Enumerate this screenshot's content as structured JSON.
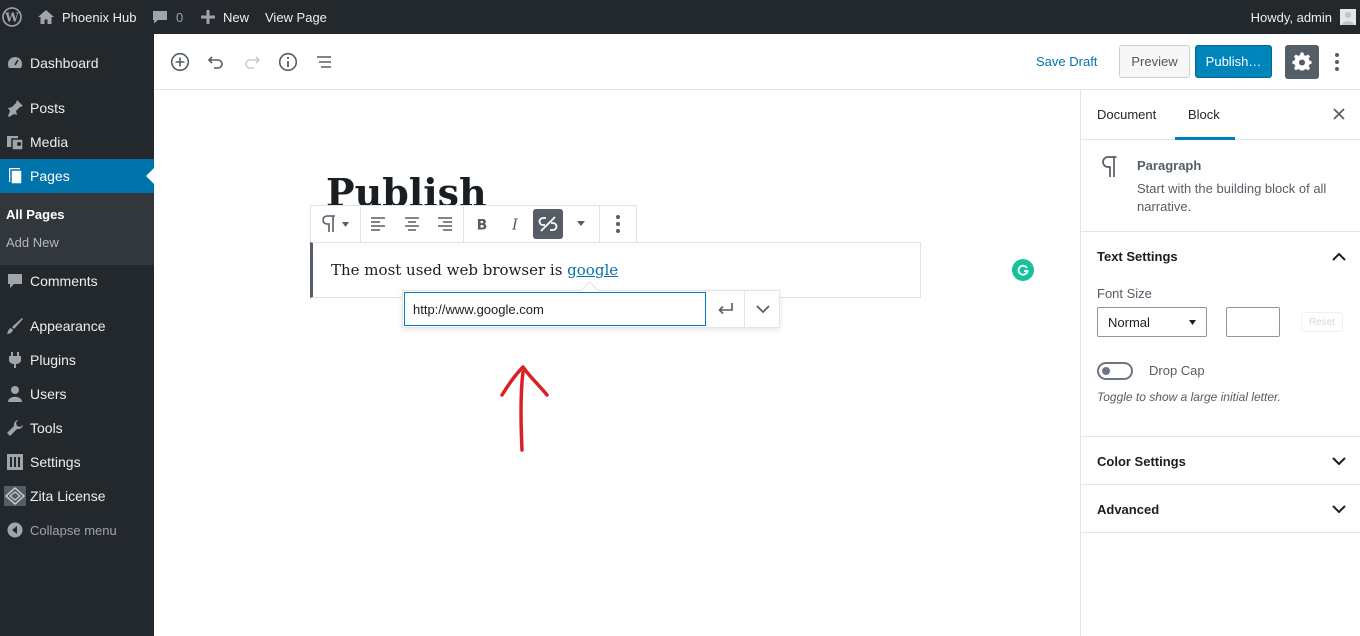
{
  "adminbar": {
    "site_name": "Phoenix Hub",
    "comments_count": "0",
    "new_label": "New",
    "view_page": "View Page",
    "greeting": "Howdy, admin"
  },
  "sidebar": {
    "items": [
      {
        "label": "Dashboard",
        "icon": "dashboard-icon"
      },
      {
        "label": "Posts",
        "icon": "pin-icon"
      },
      {
        "label": "Media",
        "icon": "media-icon"
      },
      {
        "label": "Pages",
        "icon": "pages-icon"
      },
      {
        "label": "Comments",
        "icon": "comment-icon"
      },
      {
        "label": "Appearance",
        "icon": "brush-icon"
      },
      {
        "label": "Plugins",
        "icon": "plugin-icon"
      },
      {
        "label": "Users",
        "icon": "user-icon"
      },
      {
        "label": "Tools",
        "icon": "wrench-icon"
      },
      {
        "label": "Settings",
        "icon": "settings-icon"
      },
      {
        "label": "Zita License",
        "icon": "license-icon"
      },
      {
        "label": "Collapse menu",
        "icon": "collapse-icon"
      }
    ],
    "submenu": [
      "All Pages",
      "Add New"
    ]
  },
  "toolbar": {
    "save_draft": "Save Draft",
    "preview": "Preview",
    "publish": "Publish…"
  },
  "editor": {
    "title": "Publish",
    "paragraph_text": "The most used web browser is ",
    "link_text": "google",
    "url_value": "http://www.google.com"
  },
  "panel": {
    "tabs": [
      "Document",
      "Block"
    ],
    "active_tab": "Block",
    "block_name": "Paragraph",
    "block_description": "Start with the building block of all narrative.",
    "text_settings": "Text Settings",
    "font_size_label": "Font Size",
    "font_size_value": "Normal",
    "reset": "Reset",
    "drop_cap_label": "Drop Cap",
    "drop_cap_help": "Toggle to show a large initial letter.",
    "color_settings": "Color Settings",
    "advanced": "Advanced"
  },
  "colors": {
    "adminbar": "#23282d",
    "accent": "#0073aa",
    "publish": "#0085ba",
    "annotation_arrow": "#d92025"
  }
}
